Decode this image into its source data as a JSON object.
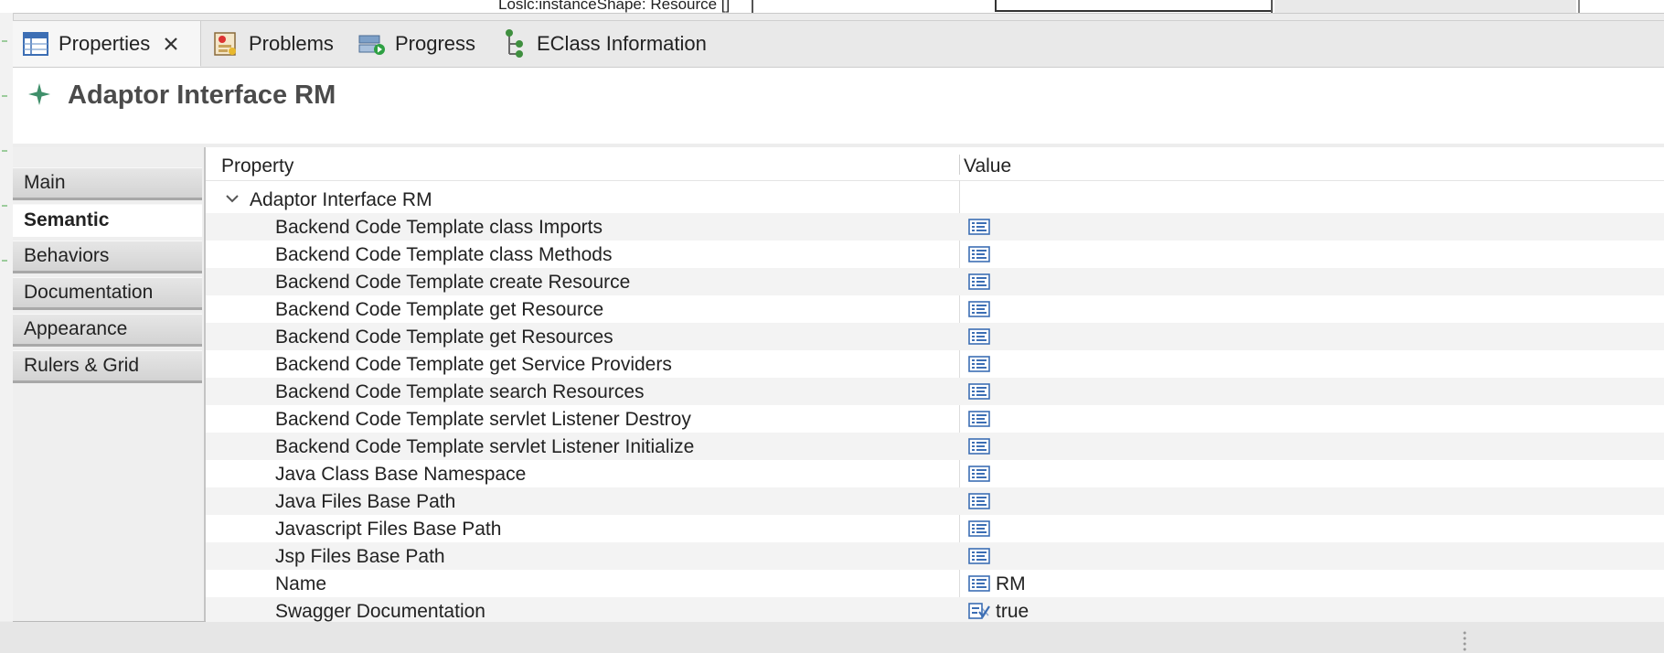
{
  "top_strip": {
    "visible_text": "Loslc:instanceShape: Resource []"
  },
  "tabs": [
    {
      "label": "Properties",
      "icon": "properties-table-icon",
      "active": true
    },
    {
      "label": "Problems",
      "icon": "problems-icon",
      "active": false
    },
    {
      "label": "Progress",
      "icon": "progress-icon",
      "active": false
    },
    {
      "label": "EClass Information",
      "icon": "eclass-tree-icon",
      "active": false
    }
  ],
  "header": {
    "title": "Adaptor Interface RM",
    "icon": "element-sparkle-icon"
  },
  "side_tabs": [
    {
      "label": "Main",
      "selected": false
    },
    {
      "label": "Semantic",
      "selected": true
    },
    {
      "label": "Behaviors",
      "selected": false
    },
    {
      "label": "Documentation",
      "selected": false
    },
    {
      "label": "Appearance",
      "selected": false
    },
    {
      "label": "Rulers & Grid",
      "selected": false
    }
  ],
  "table": {
    "col_property": "Property",
    "col_value": "Value",
    "group": "Adaptor Interface RM",
    "rows": [
      {
        "property": "Backend Code Template class Imports",
        "value": "",
        "icon": "text-property-icon"
      },
      {
        "property": "Backend Code Template class Methods",
        "value": "",
        "icon": "text-property-icon"
      },
      {
        "property": "Backend Code Template create Resource",
        "value": "",
        "icon": "text-property-icon"
      },
      {
        "property": "Backend Code Template get Resource",
        "value": "",
        "icon": "text-property-icon"
      },
      {
        "property": "Backend Code Template get Resources",
        "value": "",
        "icon": "text-property-icon"
      },
      {
        "property": "Backend Code Template get Service Providers",
        "value": "",
        "icon": "text-property-icon"
      },
      {
        "property": "Backend Code Template search Resources",
        "value": "",
        "icon": "text-property-icon"
      },
      {
        "property": "Backend Code Template servlet Listener Destroy",
        "value": "",
        "icon": "text-property-icon"
      },
      {
        "property": "Backend Code Template servlet Listener Initialize",
        "value": "",
        "icon": "text-property-icon"
      },
      {
        "property": "Java Class Base Namespace",
        "value": "",
        "icon": "text-property-icon"
      },
      {
        "property": "Java Files Base Path",
        "value": "",
        "icon": "text-property-icon"
      },
      {
        "property": "Javascript Files Base Path",
        "value": "",
        "icon": "text-property-icon"
      },
      {
        "property": "Jsp Files Base Path",
        "value": "",
        "icon": "text-property-icon"
      },
      {
        "property": "Name",
        "value": "RM",
        "icon": "text-property-icon"
      },
      {
        "property": "Swagger Documentation",
        "value": "true",
        "icon": "boolean-property-icon"
      }
    ]
  },
  "colors": {
    "accent_icon_blue": "#3c6eb4",
    "sparkle_green": "#3f8f6a"
  }
}
